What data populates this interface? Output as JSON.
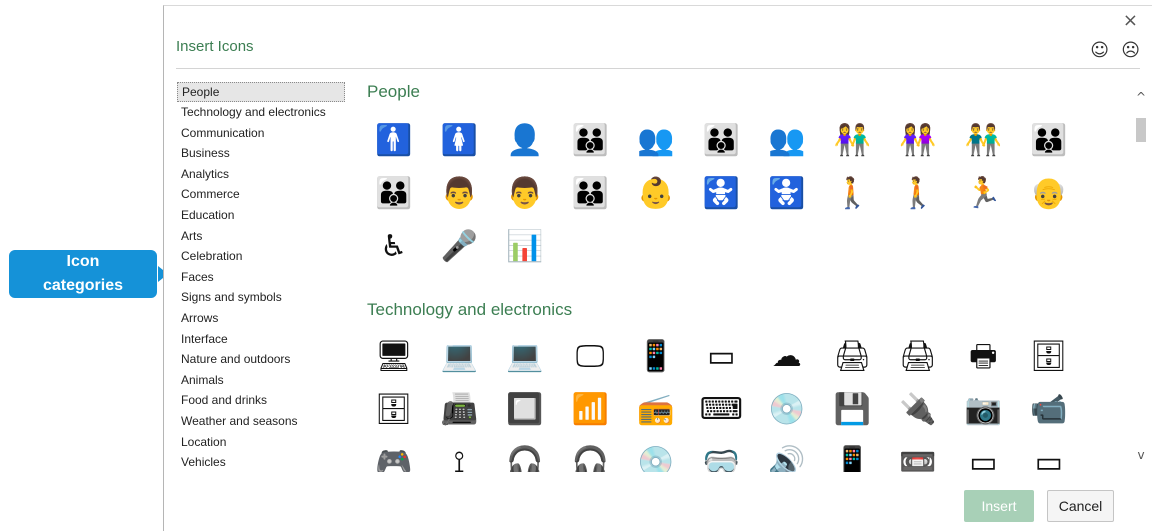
{
  "callout": {
    "line1": "Icon",
    "line2": "categories",
    "color": "#1592d8"
  },
  "dialog": {
    "title": "Insert Icons",
    "close_glyph": "×",
    "smile_glyph": "☺",
    "frown_glyph": "☹",
    "title_color": "#3c7e52"
  },
  "categories": [
    "People",
    "Technology and electronics",
    "Communication",
    "Business",
    "Analytics",
    "Commerce",
    "Education",
    "Arts",
    "Celebration",
    "Faces",
    "Signs and symbols",
    "Arrows",
    "Interface",
    "Nature and outdoors",
    "Animals",
    "Food and drinks",
    "Weather and seasons",
    "Location",
    "Vehicles"
  ],
  "selected_category": "People",
  "sections": [
    {
      "title": "People",
      "icons": [
        "man-icon",
        "woman-icon",
        "user-icon",
        "family-three-icon",
        "group-icon",
        "family-four-icon",
        "crowd-icon",
        "couple-icon",
        "two-women-icon",
        "two-men-icon",
        "family-with-child-icon",
        "parents-with-child-icon",
        "father-carrying-child-icon",
        "father-with-child-icon",
        "family-group-icon",
        "baby-icon",
        "crawling-baby-icon",
        "diaper-changing-icon",
        "crawling-man-icon",
        "walking-icon",
        "running-icon",
        "elderly-icon",
        "wheelchair-icon",
        "speaker-podium-icon",
        "presentation-icon"
      ],
      "glyphs": [
        "🚹",
        "🚺",
        "👤",
        "👪",
        "👥",
        "👪",
        "👥",
        "👫",
        "👭",
        "👬",
        "👪",
        "👪",
        "👨",
        "👨",
        "👪",
        "👶",
        "🚼",
        "🚼",
        "🚶",
        "🚶",
        "🏃",
        "👴",
        "♿",
        "🎤",
        "📊"
      ]
    },
    {
      "title": "Technology and electronics",
      "icons": [
        "desktop-computer-icon",
        "laptop-icon",
        "laptop-web-icon",
        "monitor-icon",
        "smartphone-icon",
        "tablet-icon",
        "cloud-sync-icon",
        "printer-icon",
        "fax-icon",
        "barcode-printer-icon",
        "server-rack-icon",
        "server-icon",
        "scanner-icon",
        "cpu-chip-icon",
        "wifi-router-icon",
        "radio-icon",
        "typewriter-icon",
        "cd-disc-icon",
        "floppy-disk-icon",
        "usb-cable-icon",
        "camera-icon",
        "webcam-icon",
        "gamepad-icon",
        "usb-symbol-icon",
        "earbuds-icon",
        "headphones-icon",
        "vinyl-record-icon",
        "vr-headset-icon",
        "speakers-icon",
        "phone-icon",
        "dvd-player-icon",
        "television-icon",
        "projector-screen-icon"
      ],
      "glyphs": [
        "🖥",
        "💻",
        "💻",
        "🖵",
        "📱",
        "▭",
        "☁",
        "🖨",
        "🖨",
        "🖶",
        "🗄",
        "🗄",
        "📠",
        "🔲",
        "📶",
        "📻",
        "⌨",
        "💿",
        "💾",
        "🔌",
        "📷",
        "📹",
        "🎮",
        "⟟",
        "🎧",
        "🎧",
        "💿",
        "🥽",
        "🔊",
        "📱",
        "📼",
        "▭",
        "▭"
      ]
    }
  ],
  "scrollbar": {
    "up_glyph": "^",
    "down_glyph": "v"
  },
  "buttons": {
    "insert": "Insert",
    "cancel": "Cancel",
    "insert_color": "#a8d0b7"
  }
}
